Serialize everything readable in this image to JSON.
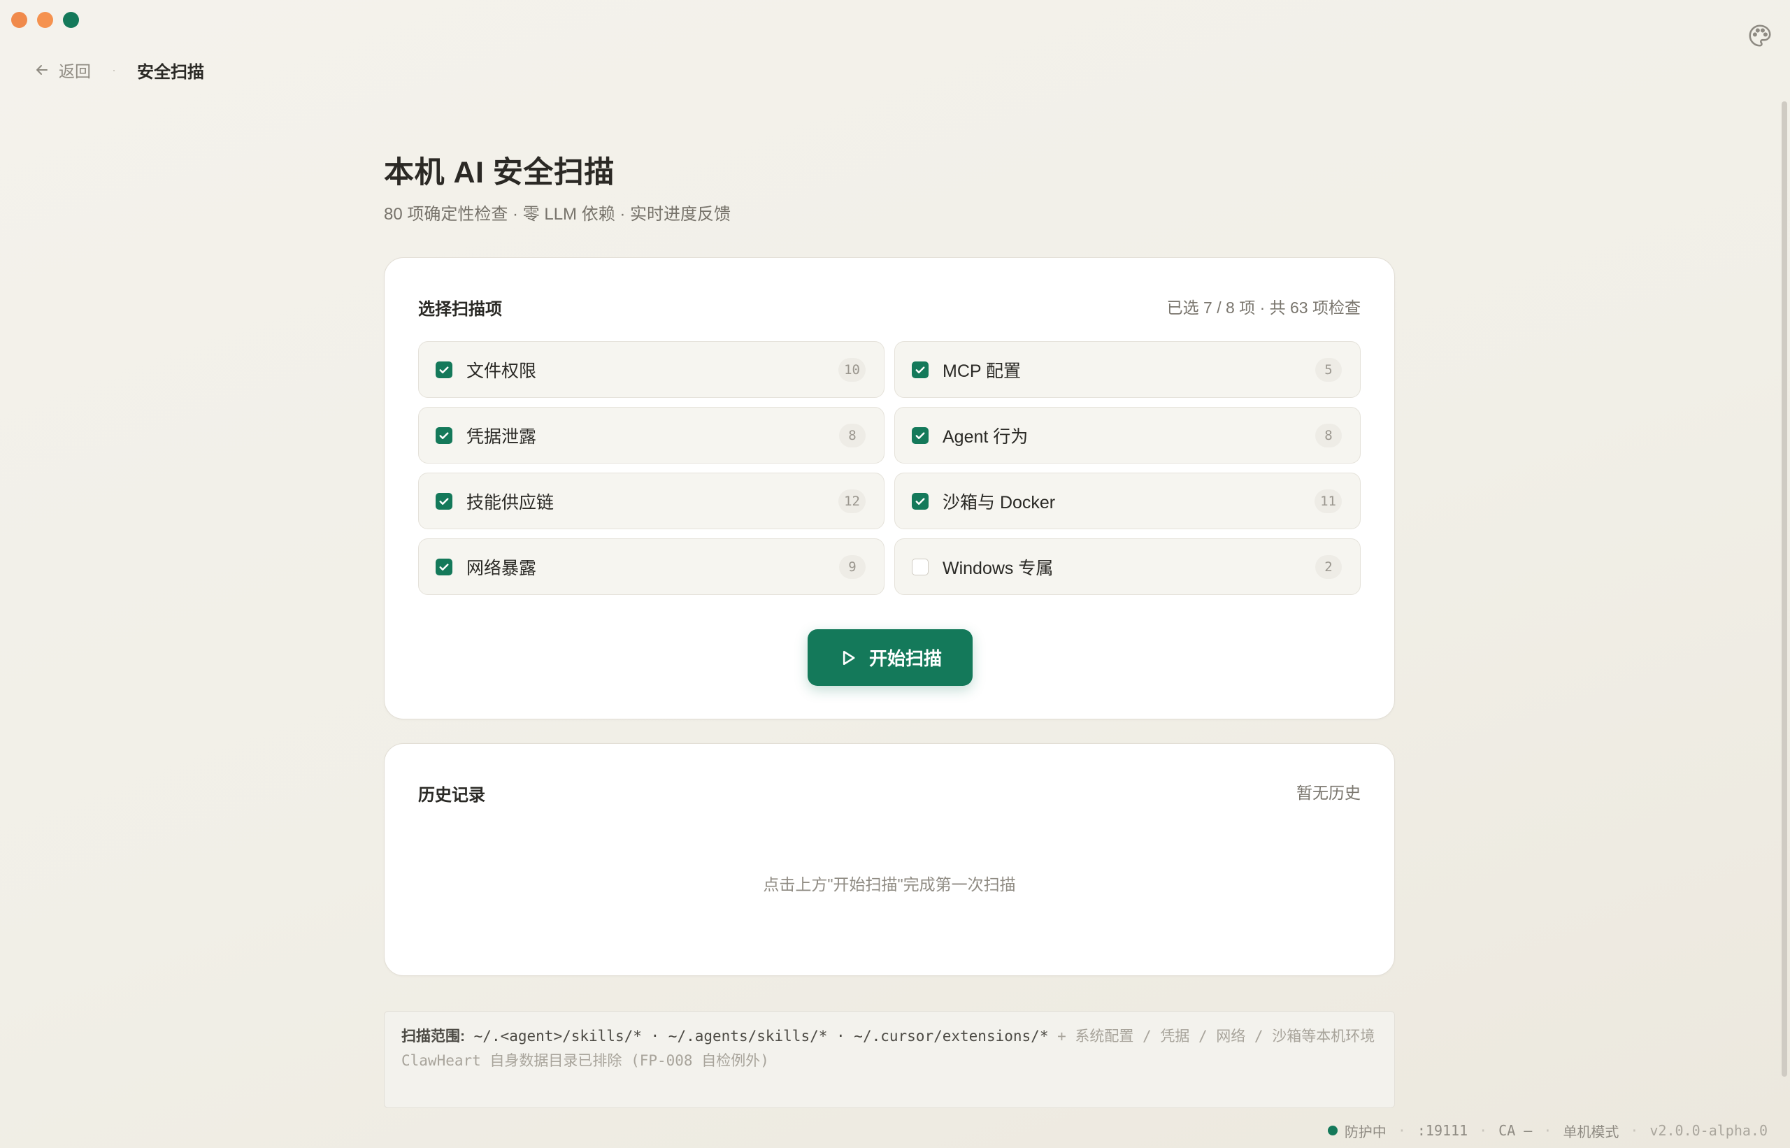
{
  "topbar": {
    "back_label": "返回",
    "title": "安全扫描"
  },
  "header": {
    "title": "本机 AI 安全扫描",
    "subtitle": "80 项确定性检查 · 零 LLM 依赖 · 实时进度反馈"
  },
  "scan": {
    "title": "选择扫描项",
    "summary": "已选 7 / 8 项 · 共 63 项检查",
    "items": [
      {
        "label": "文件权限",
        "count": "10",
        "checked": true
      },
      {
        "label": "MCP 配置",
        "count": "5",
        "checked": true
      },
      {
        "label": "凭据泄露",
        "count": "8",
        "checked": true
      },
      {
        "label": "Agent 行为",
        "count": "8",
        "checked": true
      },
      {
        "label": "技能供应链",
        "count": "12",
        "checked": true
      },
      {
        "label": "沙箱与 Docker",
        "count": "11",
        "checked": true
      },
      {
        "label": "网络暴露",
        "count": "9",
        "checked": true
      },
      {
        "label": "Windows 专属",
        "count": "2",
        "checked": false
      }
    ],
    "start_label": "开始扫描"
  },
  "history": {
    "title": "历史记录",
    "empty_tag": "暂无历史",
    "hint": "点击上方\"开始扫描\"完成第一次扫描"
  },
  "scope": {
    "label": "扫描范围:",
    "paths": "~/.<agent>/skills/* · ~/.agents/skills/* · ~/.cursor/extensions/*",
    "extra": "+ 系统配置 / 凭据 / 网络 / 沙箱等本机环境",
    "note": "ClawHeart 自身数据目录已排除 (FP-008 自检例外)"
  },
  "status": {
    "state": "防护中",
    "port": ":19111",
    "ca": "CA —",
    "mode": "单机模式",
    "version": "v2.0.0-alpha.0"
  },
  "colors": {
    "accent": "#14795a",
    "traffic_close": "#f08a4b",
    "traffic_min": "#f5924f",
    "traffic_max": "#14795a"
  },
  "icons": [
    "back-arrow-icon",
    "palette-icon",
    "check-icon",
    "play-icon"
  ]
}
